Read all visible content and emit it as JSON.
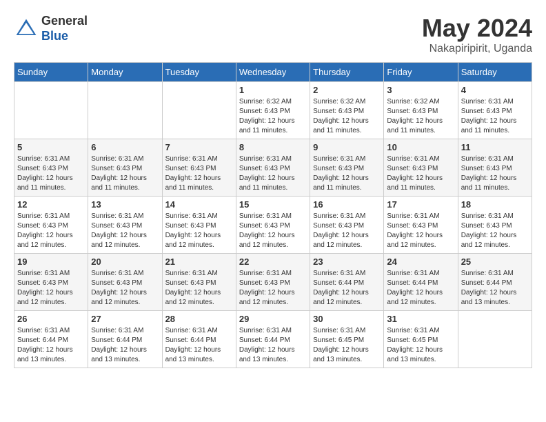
{
  "header": {
    "logo_general": "General",
    "logo_blue": "Blue",
    "title": "May 2024",
    "subtitle": "Nakapiripirit, Uganda"
  },
  "weekdays": [
    "Sunday",
    "Monday",
    "Tuesday",
    "Wednesday",
    "Thursday",
    "Friday",
    "Saturday"
  ],
  "weeks": [
    [
      {
        "day": "",
        "sunrise": "",
        "sunset": "",
        "daylight": ""
      },
      {
        "day": "",
        "sunrise": "",
        "sunset": "",
        "daylight": ""
      },
      {
        "day": "",
        "sunrise": "",
        "sunset": "",
        "daylight": ""
      },
      {
        "day": "1",
        "sunrise": "Sunrise: 6:32 AM",
        "sunset": "Sunset: 6:43 PM",
        "daylight": "Daylight: 12 hours and 11 minutes."
      },
      {
        "day": "2",
        "sunrise": "Sunrise: 6:32 AM",
        "sunset": "Sunset: 6:43 PM",
        "daylight": "Daylight: 12 hours and 11 minutes."
      },
      {
        "day": "3",
        "sunrise": "Sunrise: 6:32 AM",
        "sunset": "Sunset: 6:43 PM",
        "daylight": "Daylight: 12 hours and 11 minutes."
      },
      {
        "day": "4",
        "sunrise": "Sunrise: 6:31 AM",
        "sunset": "Sunset: 6:43 PM",
        "daylight": "Daylight: 12 hours and 11 minutes."
      }
    ],
    [
      {
        "day": "5",
        "sunrise": "Sunrise: 6:31 AM",
        "sunset": "Sunset: 6:43 PM",
        "daylight": "Daylight: 12 hours and 11 minutes."
      },
      {
        "day": "6",
        "sunrise": "Sunrise: 6:31 AM",
        "sunset": "Sunset: 6:43 PM",
        "daylight": "Daylight: 12 hours and 11 minutes."
      },
      {
        "day": "7",
        "sunrise": "Sunrise: 6:31 AM",
        "sunset": "Sunset: 6:43 PM",
        "daylight": "Daylight: 12 hours and 11 minutes."
      },
      {
        "day": "8",
        "sunrise": "Sunrise: 6:31 AM",
        "sunset": "Sunset: 6:43 PM",
        "daylight": "Daylight: 12 hours and 11 minutes."
      },
      {
        "day": "9",
        "sunrise": "Sunrise: 6:31 AM",
        "sunset": "Sunset: 6:43 PM",
        "daylight": "Daylight: 12 hours and 11 minutes."
      },
      {
        "day": "10",
        "sunrise": "Sunrise: 6:31 AM",
        "sunset": "Sunset: 6:43 PM",
        "daylight": "Daylight: 12 hours and 11 minutes."
      },
      {
        "day": "11",
        "sunrise": "Sunrise: 6:31 AM",
        "sunset": "Sunset: 6:43 PM",
        "daylight": "Daylight: 12 hours and 11 minutes."
      }
    ],
    [
      {
        "day": "12",
        "sunrise": "Sunrise: 6:31 AM",
        "sunset": "Sunset: 6:43 PM",
        "daylight": "Daylight: 12 hours and 12 minutes."
      },
      {
        "day": "13",
        "sunrise": "Sunrise: 6:31 AM",
        "sunset": "Sunset: 6:43 PM",
        "daylight": "Daylight: 12 hours and 12 minutes."
      },
      {
        "day": "14",
        "sunrise": "Sunrise: 6:31 AM",
        "sunset": "Sunset: 6:43 PM",
        "daylight": "Daylight: 12 hours and 12 minutes."
      },
      {
        "day": "15",
        "sunrise": "Sunrise: 6:31 AM",
        "sunset": "Sunset: 6:43 PM",
        "daylight": "Daylight: 12 hours and 12 minutes."
      },
      {
        "day": "16",
        "sunrise": "Sunrise: 6:31 AM",
        "sunset": "Sunset: 6:43 PM",
        "daylight": "Daylight: 12 hours and 12 minutes."
      },
      {
        "day": "17",
        "sunrise": "Sunrise: 6:31 AM",
        "sunset": "Sunset: 6:43 PM",
        "daylight": "Daylight: 12 hours and 12 minutes."
      },
      {
        "day": "18",
        "sunrise": "Sunrise: 6:31 AM",
        "sunset": "Sunset: 6:43 PM",
        "daylight": "Daylight: 12 hours and 12 minutes."
      }
    ],
    [
      {
        "day": "19",
        "sunrise": "Sunrise: 6:31 AM",
        "sunset": "Sunset: 6:43 PM",
        "daylight": "Daylight: 12 hours and 12 minutes."
      },
      {
        "day": "20",
        "sunrise": "Sunrise: 6:31 AM",
        "sunset": "Sunset: 6:43 PM",
        "daylight": "Daylight: 12 hours and 12 minutes."
      },
      {
        "day": "21",
        "sunrise": "Sunrise: 6:31 AM",
        "sunset": "Sunset: 6:43 PM",
        "daylight": "Daylight: 12 hours and 12 minutes."
      },
      {
        "day": "22",
        "sunrise": "Sunrise: 6:31 AM",
        "sunset": "Sunset: 6:43 PM",
        "daylight": "Daylight: 12 hours and 12 minutes."
      },
      {
        "day": "23",
        "sunrise": "Sunrise: 6:31 AM",
        "sunset": "Sunset: 6:44 PM",
        "daylight": "Daylight: 12 hours and 12 minutes."
      },
      {
        "day": "24",
        "sunrise": "Sunrise: 6:31 AM",
        "sunset": "Sunset: 6:44 PM",
        "daylight": "Daylight: 12 hours and 12 minutes."
      },
      {
        "day": "25",
        "sunrise": "Sunrise: 6:31 AM",
        "sunset": "Sunset: 6:44 PM",
        "daylight": "Daylight: 12 hours and 13 minutes."
      }
    ],
    [
      {
        "day": "26",
        "sunrise": "Sunrise: 6:31 AM",
        "sunset": "Sunset: 6:44 PM",
        "daylight": "Daylight: 12 hours and 13 minutes."
      },
      {
        "day": "27",
        "sunrise": "Sunrise: 6:31 AM",
        "sunset": "Sunset: 6:44 PM",
        "daylight": "Daylight: 12 hours and 13 minutes."
      },
      {
        "day": "28",
        "sunrise": "Sunrise: 6:31 AM",
        "sunset": "Sunset: 6:44 PM",
        "daylight": "Daylight: 12 hours and 13 minutes."
      },
      {
        "day": "29",
        "sunrise": "Sunrise: 6:31 AM",
        "sunset": "Sunset: 6:44 PM",
        "daylight": "Daylight: 12 hours and 13 minutes."
      },
      {
        "day": "30",
        "sunrise": "Sunrise: 6:31 AM",
        "sunset": "Sunset: 6:45 PM",
        "daylight": "Daylight: 12 hours and 13 minutes."
      },
      {
        "day": "31",
        "sunrise": "Sunrise: 6:31 AM",
        "sunset": "Sunset: 6:45 PM",
        "daylight": "Daylight: 12 hours and 13 minutes."
      },
      {
        "day": "",
        "sunrise": "",
        "sunset": "",
        "daylight": ""
      }
    ]
  ]
}
